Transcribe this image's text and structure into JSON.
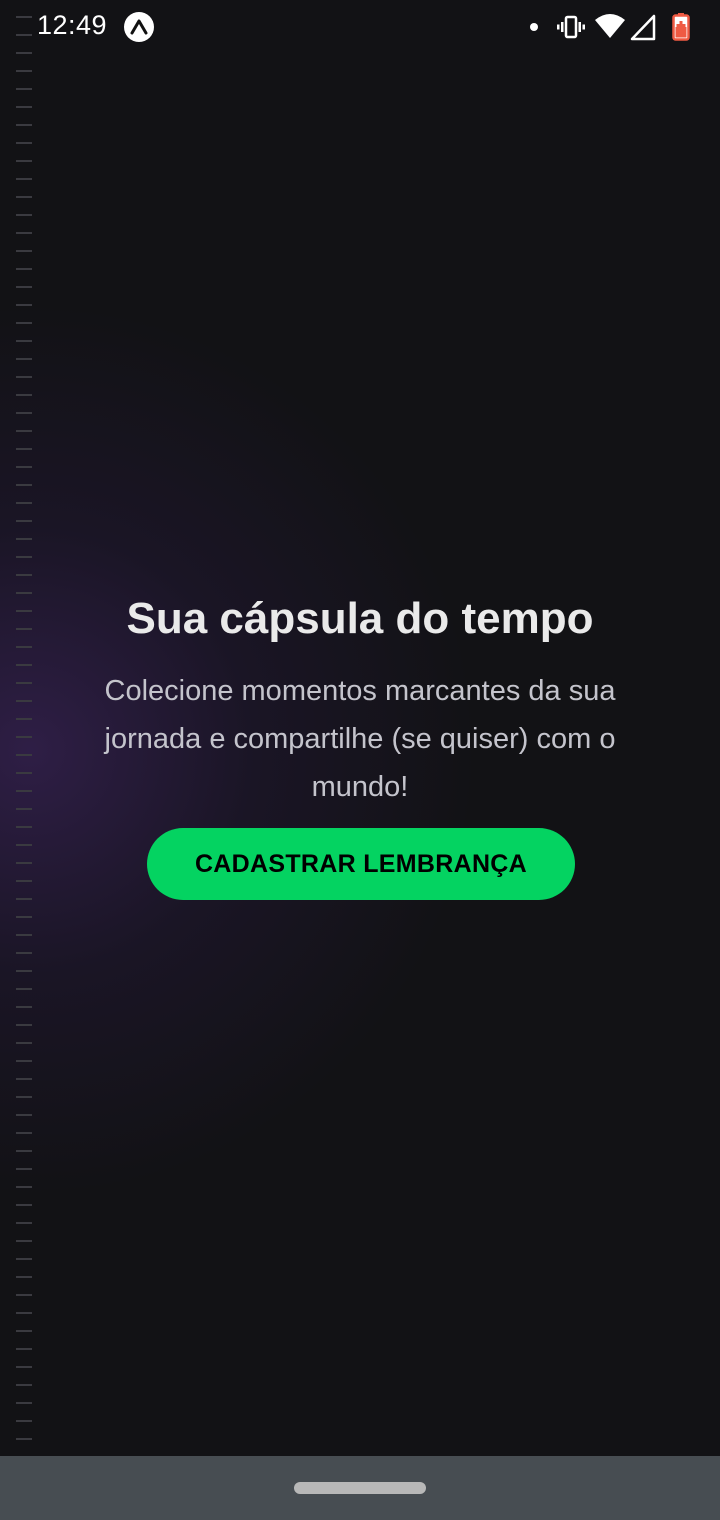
{
  "status_bar": {
    "time": "12:49",
    "icons": [
      "expo-icon",
      "dot-icon",
      "vibrate-icon",
      "wifi-icon",
      "signal-icon",
      "battery-icon"
    ]
  },
  "main": {
    "title": "Sua cápsula do tempo",
    "subtitle": "Colecione momentos marcantes da sua jornada e compartilhe (se quiser) com o mundo!",
    "cta_label": "CADASTRAR LEMBRANÇA"
  },
  "colors": {
    "background": "#121215",
    "accent": "#04d361",
    "title": "#eaeaea",
    "subtitle": "#c4c4cc",
    "glow": "#2e1c4b",
    "nav_bar": "#474d52"
  }
}
